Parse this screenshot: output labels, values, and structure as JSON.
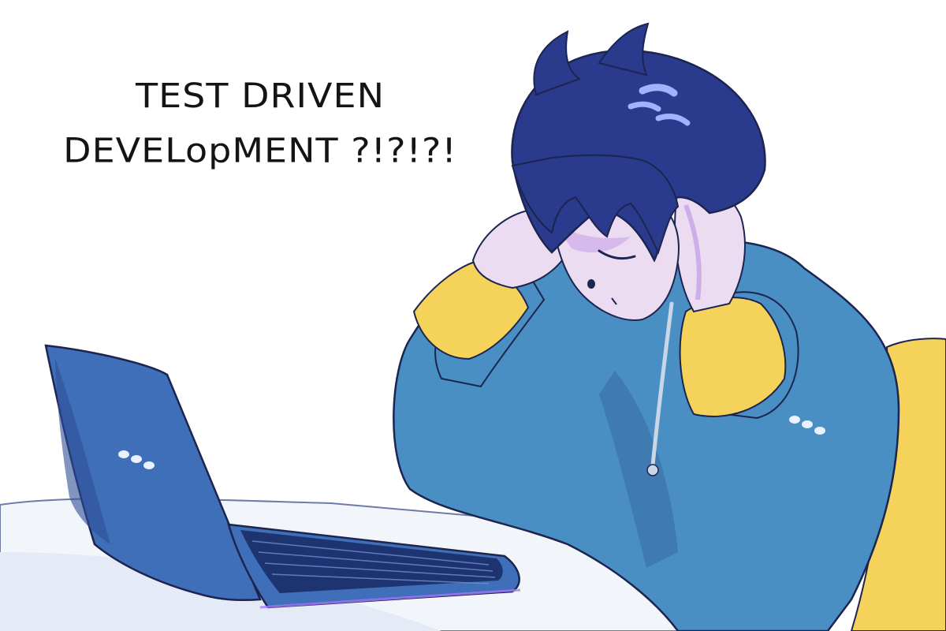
{
  "caption": {
    "line1": "TEST DRIVEN",
    "line2": "DEVELopMENT ?!?!?!"
  },
  "colors": {
    "background": "#ffffff",
    "hair": "#2a3a8c",
    "hair_highlight": "#9fb4ff",
    "sweater": "#4a8fc4",
    "sweater_shadow": "#3a72a8",
    "cuffs": "#f5d35a",
    "skin": "#ecdcf2",
    "skin_shadow": "#c7a3e6",
    "laptop": "#3f6fb8",
    "laptop_dark": "#2d4f94",
    "keys": "#1e3470",
    "table": "#f2f6fb",
    "chair": "#f5d35a",
    "outline": "#1c2450"
  },
  "icons": {
    "laptop_logo": "laptop-logo-icon",
    "sleeve_logo": "sleeve-logo-icon"
  }
}
